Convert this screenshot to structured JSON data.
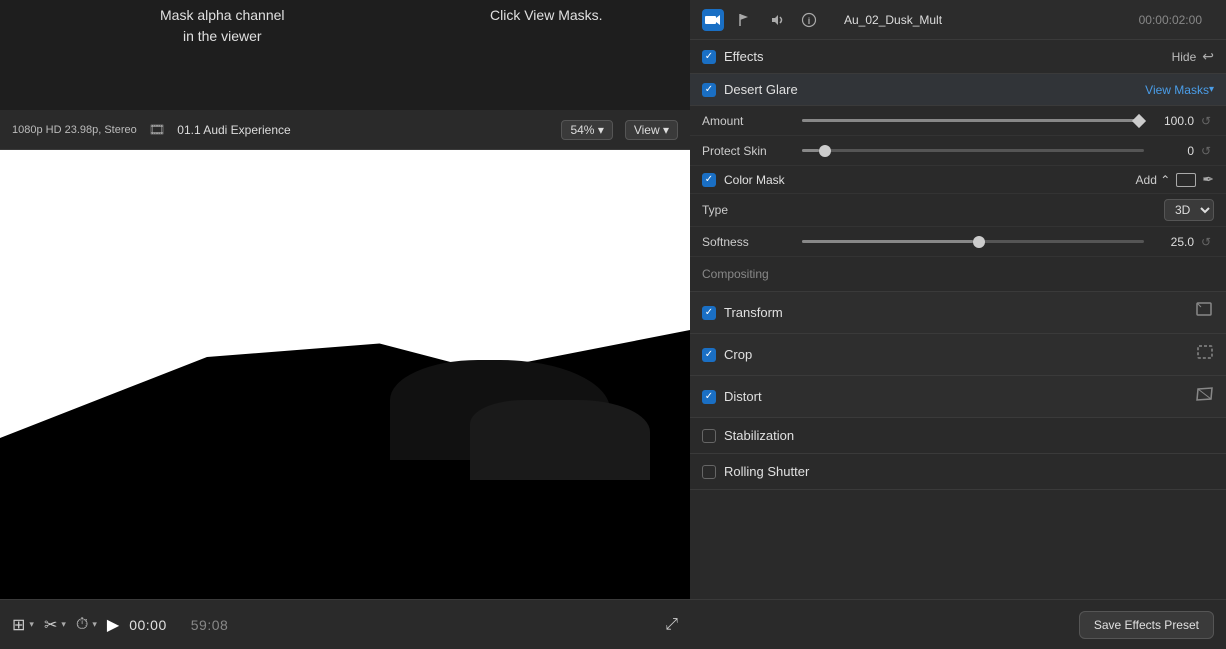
{
  "annotations": {
    "mask_tooltip": "Mask alpha channel\nin the viewer",
    "click_tooltip": "Click View Masks."
  },
  "header": {
    "resolution": "1080p HD 23.98p, Stereo",
    "clip_name": "01.1 Audi Experience",
    "zoom": "54%",
    "view": "View"
  },
  "inspector": {
    "clip_title": "Au_02_Dusk_Mult",
    "clip_timecode": "00:00:02:00",
    "hide_label": "Hide",
    "undo_icon": "↩"
  },
  "effects": {
    "header_label": "Effects",
    "desert_glare_label": "Desert Glare",
    "view_masks_label": "View Masks",
    "amount_label": "Amount",
    "amount_value": "100.0",
    "protect_skin_label": "Protect Skin",
    "protect_skin_value": "0",
    "color_mask_label": "Color Mask",
    "add_label": "Add",
    "type_label": "Type",
    "type_value": "3D",
    "softness_label": "Softness",
    "softness_value": "25.0",
    "compositing_label": "Compositing",
    "transform_label": "Transform",
    "crop_label": "Crop",
    "distort_label": "Distort",
    "stabilization_label": "Stabilization",
    "rolling_shutter_label": "Rolling Shutter",
    "save_preset_label": "Save Effects Preset"
  },
  "timeline": {
    "current_time": "00:00",
    "total_time": "59:08",
    "play_icon": "▶"
  },
  "icons": {
    "film_reel": "🎬",
    "video": "📹",
    "clip_icon": "⬛",
    "film_icon": "🎞"
  }
}
